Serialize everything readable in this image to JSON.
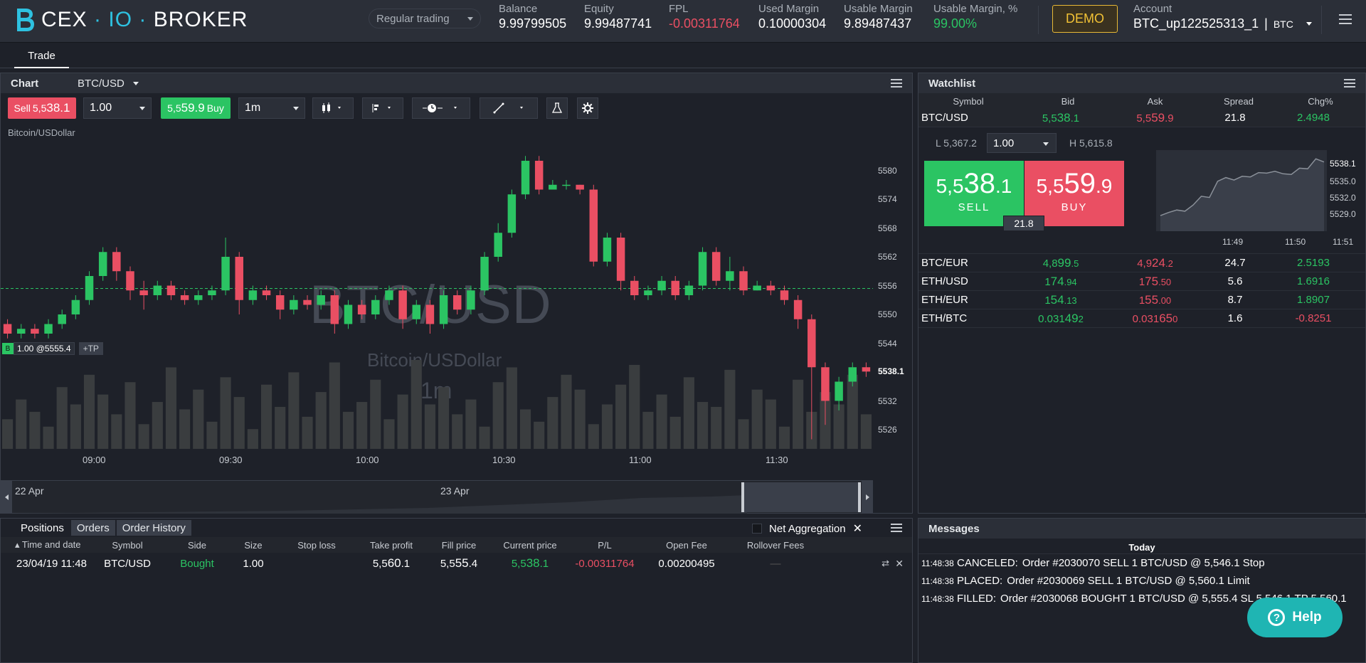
{
  "brand": {
    "name_left": "CEX",
    "name_mid": "IO",
    "name_right": "BROKER"
  },
  "header": {
    "mode": "Regular trading",
    "stats": [
      {
        "label": "Balance",
        "value": "9.99799505",
        "tone": "normal"
      },
      {
        "label": "Equity",
        "value": "9.99487741",
        "tone": "normal"
      },
      {
        "label": "FPL",
        "value": "-0.00311764",
        "tone": "neg"
      },
      {
        "label": "Used Margin",
        "value": "0.10000304",
        "tone": "normal"
      },
      {
        "label": "Usable Margin",
        "value": "9.89487437",
        "tone": "normal"
      },
      {
        "label": "Usable Margin, %",
        "value": "99.00%",
        "tone": "pos"
      }
    ],
    "demo_label": "DEMO",
    "account_label": "Account",
    "account_value": "BTC_up122525313_1",
    "account_currency": "BTC"
  },
  "tabs": {
    "trade": "Trade"
  },
  "chart_panel": {
    "title": "Chart",
    "symbol": "BTC/USD",
    "sell_label": "Sell",
    "sell_price_a": "5,5",
    "sell_price_b": "38.1",
    "buy_label": "Buy",
    "buy_price_a": "5,5",
    "buy_price_b": "59.9",
    "quantity": "1.00",
    "timeframe": "1m",
    "subtitle": "Bitcoin/USDollar",
    "watermark_symbol": "BTC/USD",
    "watermark_name": "Bitcoin/USDollar",
    "watermark_timeframe": "1m",
    "position_marker": "1.00 @5555.4",
    "position_side_badge": "B",
    "tp_label": "+TP",
    "last_price_label": "5538.1",
    "nav_dates": [
      "22 Apr",
      "23 Apr"
    ]
  },
  "chart_data": {
    "type": "candlestick",
    "y_ticks": [
      5580.0,
      5574.0,
      5568.0,
      5562.0,
      5556.0,
      5550.0,
      5544.0,
      5538.1,
      5532.0,
      5526.0
    ],
    "x_ticks": [
      "09:00",
      "09:30",
      "10:00",
      "10:30",
      "11:00",
      "11:30"
    ],
    "ylim": [
      5522,
      5586
    ],
    "position_line": 5555.4,
    "last_price": 5538.1,
    "candles": [
      {
        "o": 5548,
        "c": 5546,
        "h": 5549,
        "l": 5545
      },
      {
        "o": 5546,
        "c": 5547,
        "h": 5548,
        "l": 5545
      },
      {
        "o": 5547,
        "c": 5546,
        "h": 5548,
        "l": 5545
      },
      {
        "o": 5546,
        "c": 5548,
        "h": 5549,
        "l": 5545
      },
      {
        "o": 5548,
        "c": 5550,
        "h": 5551,
        "l": 5547
      },
      {
        "o": 5550,
        "c": 5553,
        "h": 5554,
        "l": 5549
      },
      {
        "o": 5553,
        "c": 5558,
        "h": 5559,
        "l": 5552
      },
      {
        "o": 5558,
        "c": 5563,
        "h": 5564,
        "l": 5557
      },
      {
        "o": 5563,
        "c": 5559,
        "h": 5564,
        "l": 5557
      },
      {
        "o": 5559,
        "c": 5555,
        "h": 5560,
        "l": 5553
      },
      {
        "o": 5555,
        "c": 5554,
        "h": 5557,
        "l": 5551
      },
      {
        "o": 5554,
        "c": 5556,
        "h": 5557,
        "l": 5553
      },
      {
        "o": 5556,
        "c": 5554,
        "h": 5557,
        "l": 5553
      },
      {
        "o": 5554,
        "c": 5553,
        "h": 5555,
        "l": 5552
      },
      {
        "o": 5553,
        "c": 5554,
        "h": 5555,
        "l": 5552
      },
      {
        "o": 5554,
        "c": 5555,
        "h": 5556,
        "l": 5553
      },
      {
        "o": 5555,
        "c": 5562,
        "h": 5566,
        "l": 5554
      },
      {
        "o": 5562,
        "c": 5553,
        "h": 5563,
        "l": 5550
      },
      {
        "o": 5553,
        "c": 5555,
        "h": 5556,
        "l": 5552
      },
      {
        "o": 5555,
        "c": 5554,
        "h": 5556,
        "l": 5553
      },
      {
        "o": 5554,
        "c": 5551,
        "h": 5555,
        "l": 5549
      },
      {
        "o": 5551,
        "c": 5553,
        "h": 5554,
        "l": 5550
      },
      {
        "o": 5553,
        "c": 5552,
        "h": 5554,
        "l": 5551
      },
      {
        "o": 5552,
        "c": 5554,
        "h": 5555,
        "l": 5551
      },
      {
        "o": 5554,
        "c": 5548,
        "h": 5555,
        "l": 5546
      },
      {
        "o": 5548,
        "c": 5552,
        "h": 5553,
        "l": 5547
      },
      {
        "o": 5552,
        "c": 5550,
        "h": 5553,
        "l": 5549
      },
      {
        "o": 5550,
        "c": 5553,
        "h": 5554,
        "l": 5549
      },
      {
        "o": 5553,
        "c": 5555,
        "h": 5556,
        "l": 5552
      },
      {
        "o": 5555,
        "c": 5549,
        "h": 5556,
        "l": 5547
      },
      {
        "o": 5549,
        "c": 5552,
        "h": 5553,
        "l": 5548
      },
      {
        "o": 5552,
        "c": 5548,
        "h": 5553,
        "l": 5546
      },
      {
        "o": 5548,
        "c": 5554,
        "h": 5555,
        "l": 5547
      },
      {
        "o": 5554,
        "c": 5551,
        "h": 5555,
        "l": 5550
      },
      {
        "o": 5551,
        "c": 5555,
        "h": 5556,
        "l": 5550
      },
      {
        "o": 5555,
        "c": 5562,
        "h": 5563,
        "l": 5554
      },
      {
        "o": 5562,
        "c": 5567,
        "h": 5569,
        "l": 5561
      },
      {
        "o": 5567,
        "c": 5575,
        "h": 5576,
        "l": 5566
      },
      {
        "o": 5575,
        "c": 5582,
        "h": 5583,
        "l": 5574
      },
      {
        "o": 5582,
        "c": 5576,
        "h": 5583,
        "l": 5575
      },
      {
        "o": 5576,
        "c": 5577,
        "h": 5578,
        "l": 5576
      },
      {
        "o": 5577,
        "c": 5577,
        "h": 5578,
        "l": 5576
      },
      {
        "o": 5577,
        "c": 5576,
        "h": 5577,
        "l": 5575
      },
      {
        "o": 5576,
        "c": 5561,
        "h": 5577,
        "l": 5560
      },
      {
        "o": 5561,
        "c": 5566,
        "h": 5567,
        "l": 5560
      },
      {
        "o": 5566,
        "c": 5557,
        "h": 5567,
        "l": 5555
      },
      {
        "o": 5557,
        "c": 5554,
        "h": 5558,
        "l": 5553
      },
      {
        "o": 5554,
        "c": 5555,
        "h": 5556,
        "l": 5553
      },
      {
        "o": 5555,
        "c": 5557,
        "h": 5558,
        "l": 5554
      },
      {
        "o": 5557,
        "c": 5554,
        "h": 5558,
        "l": 5553
      },
      {
        "o": 5554,
        "c": 5556,
        "h": 5557,
        "l": 5553
      },
      {
        "o": 5556,
        "c": 5563,
        "h": 5564,
        "l": 5555
      },
      {
        "o": 5563,
        "c": 5557,
        "h": 5564,
        "l": 5556
      },
      {
        "o": 5557,
        "c": 5559,
        "h": 5562,
        "l": 5555
      },
      {
        "o": 5559,
        "c": 5555,
        "h": 5560,
        "l": 5554
      },
      {
        "o": 5555,
        "c": 5556,
        "h": 5557,
        "l": 5555
      },
      {
        "o": 5556,
        "c": 5555,
        "h": 5557,
        "l": 5554
      },
      {
        "o": 5555,
        "c": 5553,
        "h": 5556,
        "l": 5552
      },
      {
        "o": 5553,
        "c": 5549,
        "h": 5554,
        "l": 5547
      },
      {
        "o": 5549,
        "c": 5539,
        "h": 5550,
        "l": 5524
      },
      {
        "o": 5539,
        "c": 5532,
        "h": 5540,
        "l": 5527
      },
      {
        "o": 5532,
        "c": 5536,
        "h": 5537,
        "l": 5530
      },
      {
        "o": 5536,
        "c": 5539,
        "h": 5540,
        "l": 5535
      },
      {
        "o": 5539,
        "c": 5538.1,
        "h": 5540,
        "l": 5537
      }
    ],
    "volumes": [
      12,
      20,
      15,
      9,
      25,
      18,
      30,
      22,
      14,
      27,
      10,
      19,
      33,
      16,
      24,
      11,
      29,
      21,
      8,
      26,
      17,
      31,
      13,
      23,
      35,
      15,
      19,
      28,
      12,
      22,
      36,
      18,
      25,
      14,
      20,
      9,
      27,
      33,
      16,
      11,
      21,
      30,
      24,
      10,
      18,
      26,
      34,
      15,
      22,
      13,
      29,
      19,
      17,
      32,
      12,
      24,
      20,
      9,
      28,
      15,
      23,
      18,
      30,
      14
    ]
  },
  "watchlist": {
    "title": "Watchlist",
    "columns": [
      "Symbol",
      "Bid",
      "Ask",
      "Spread",
      "Chg%"
    ],
    "expanded": {
      "symbol": "BTC/USD",
      "bid_a": "5,5",
      "bid_b": "38",
      "bid_c": ".1",
      "ask_a": "5,5",
      "ask_b": "59",
      "ask_c": ".9",
      "spread": "21.8",
      "chg": "2.4948",
      "low": "L 5,367.2",
      "high": "H 5,615.8",
      "quantity": "1.00",
      "sell_a": "5,5",
      "sell_b": "38",
      "sell_c": ".1",
      "sell_label": "SELL",
      "buy_a": "5,5",
      "buy_b": "59",
      "buy_c": ".9",
      "buy_label": "BUY",
      "spread_badge": "21.8",
      "mini_y_ticks": [
        "5538.1",
        "5535.0",
        "5532.0",
        "5529.0"
      ],
      "mini_x_ticks": [
        "11:49",
        "11:50",
        "11:51"
      ]
    },
    "rows": [
      {
        "symbol": "BTC/EUR",
        "bid_a": "4,8",
        "bid_b": "99",
        "bid_c": ".5",
        "ask_a": "4,9",
        "ask_b": "24",
        "ask_c": ".2",
        "spread": "24.7",
        "chg": "2.5193",
        "tone": "pos"
      },
      {
        "symbol": "ETH/USD",
        "bid_a": "1",
        "bid_b": "74",
        "bid_c": ".94",
        "ask_a": "1",
        "ask_b": "75",
        "ask_c": ".50",
        "spread": "5.6",
        "chg": "1.6916",
        "tone": "pos"
      },
      {
        "symbol": "ETH/EUR",
        "bid_a": "1",
        "bid_b": "54",
        "bid_c": ".13",
        "ask_a": "1",
        "ask_b": "55",
        "ask_c": ".00",
        "spread": "8.7",
        "chg": "1.8907",
        "tone": "pos"
      },
      {
        "symbol": "ETH/BTC",
        "bid_a": "0.031",
        "bid_b": "49",
        "bid_c": "2",
        "ask_a": "0.031",
        "ask_b": "65",
        "ask_c": "0",
        "spread": "1.6",
        "chg": "-0.8251",
        "tone": "neg"
      }
    ]
  },
  "mini_chart": {
    "values": [
      5529.5,
      5530.0,
      5530.4,
      5530.2,
      5531.2,
      5532.6,
      5532.4,
      5535.0,
      5535.6,
      5535.2,
      5535.8,
      5535.7,
      5536.4,
      5536.3,
      5536.6,
      5536.2,
      5536.1,
      5537.1,
      5537.0,
      5538.6,
      5538.1
    ]
  },
  "positions": {
    "tabs": [
      "Positions",
      "Orders",
      "Order History"
    ],
    "aggregation": "Net Aggregation",
    "columns": [
      "Time and date",
      "Symbol",
      "Side",
      "Size",
      "Stop loss",
      "Take profit",
      "Fill price",
      "Current price",
      "P/L",
      "Open Fee",
      "Rollover Fees"
    ],
    "row": {
      "time": "23/04/19 11:48",
      "symbol": "BTC/USD",
      "side": "Bought",
      "size": "1.00",
      "stop_loss": "",
      "tp_a": "5,5",
      "tp_b": "60",
      "tp_c": ".1",
      "fill_a": "5,5",
      "fill_b": "55",
      "fill_c": ".4",
      "cur_a": "5,5",
      "cur_b": "38",
      "cur_c": ".1",
      "pl": "-0.00311764",
      "open_fee": "0.00200495",
      "rollover": "—"
    }
  },
  "messages": {
    "title": "Messages",
    "day": "Today",
    "items": [
      {
        "time": "11:48:38",
        "type": "CANCELED:",
        "text": "Order #2030070 SELL 1 BTC/USD @ 5,546.1 Stop"
      },
      {
        "time": "11:48:38",
        "type": "PLACED:",
        "text": "Order #2030069 SELL 1 BTC/USD @ 5,560.1 Limit"
      },
      {
        "time": "11:48:38",
        "type": "FILLED:",
        "text": "Order #2030068 BOUGHT 1 BTC/USD @ 5,555.4 SL 5,546.1 TP 5,560.1"
      }
    ]
  },
  "help": {
    "label": "Help"
  },
  "colors": {
    "up": "#2bc463",
    "down": "#ea4f63",
    "bg": "#1e2129",
    "accent": "#1fb5b3"
  }
}
